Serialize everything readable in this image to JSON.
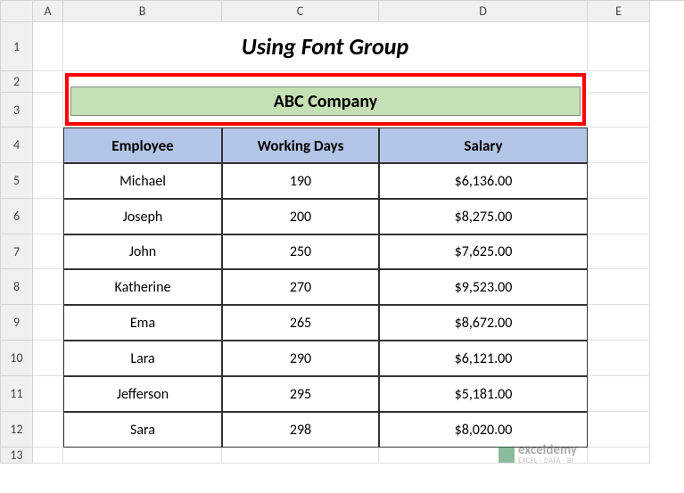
{
  "columns": [
    "A",
    "B",
    "C",
    "D",
    "E"
  ],
  "rows": [
    "1",
    "2",
    "3",
    "4",
    "5",
    "6",
    "7",
    "8",
    "9",
    "10",
    "11",
    "12",
    "13"
  ],
  "title": "Using Font Group",
  "company": "ABC Company",
  "headers": {
    "employee": "Employee",
    "working_days": "Working Days",
    "salary": "Salary"
  },
  "table": [
    {
      "employee": "Michael",
      "days": "190",
      "salary": "$6,136.00"
    },
    {
      "employee": "Joseph",
      "days": "200",
      "salary": "$8,275.00"
    },
    {
      "employee": "John",
      "days": "250",
      "salary": "$7,625.00"
    },
    {
      "employee": "Katherine",
      "days": "270",
      "salary": "$9,523.00"
    },
    {
      "employee": "Ema",
      "days": "265",
      "salary": "$8,672.00"
    },
    {
      "employee": "Lara",
      "days": "290",
      "salary": "$6,121.00"
    },
    {
      "employee": "Jefferson",
      "days": "295",
      "salary": "$5,181.00"
    },
    {
      "employee": "Sara",
      "days": "298",
      "salary": "$8,020.00"
    }
  ],
  "watermark": {
    "main": "exceldemy",
    "sub": "EXCEL · DATA · BI"
  },
  "chart_data": {
    "type": "table",
    "title": "ABC Company",
    "columns": [
      "Employee",
      "Working Days",
      "Salary"
    ],
    "rows": [
      [
        "Michael",
        190,
        6136.0
      ],
      [
        "Joseph",
        200,
        8275.0
      ],
      [
        "John",
        250,
        7625.0
      ],
      [
        "Katherine",
        270,
        9523.0
      ],
      [
        "Ema",
        265,
        8672.0
      ],
      [
        "Lara",
        290,
        6121.0
      ],
      [
        "Jefferson",
        295,
        5181.0
      ],
      [
        "Sara",
        298,
        8020.0
      ]
    ]
  }
}
